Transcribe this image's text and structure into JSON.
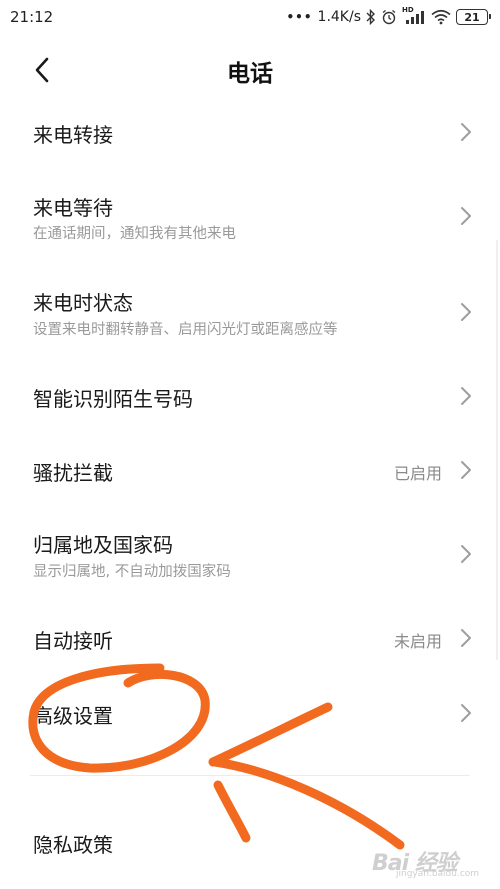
{
  "status_bar": {
    "time": "21:12",
    "net_speed": "1.4K/s",
    "hd_label": "HD",
    "battery_level": "21",
    "icons": [
      "dots-icon",
      "bluetooth-icon",
      "alarm-icon",
      "signal-icon",
      "wifi-icon",
      "battery-icon"
    ]
  },
  "header": {
    "title": "电话",
    "back_icon": "chevron-left-icon"
  },
  "items": [
    {
      "label": "来电转接"
    },
    {
      "label": "来电等待",
      "sub": "在通话期间，通知我有其他来电"
    },
    {
      "label": "来电时状态",
      "sub": "设置来电时翻转静音、启用闪光灯或距离感应等"
    },
    {
      "label": "智能识别陌生号码"
    },
    {
      "label": "骚扰拦截",
      "value": "已启用"
    },
    {
      "label": "归属地及国家码",
      "sub": "显示归属地, 不自动加拨国家码"
    },
    {
      "label": "自动接听",
      "value": "未启用"
    },
    {
      "label": "高级设置"
    },
    {
      "label": "隐私政策"
    }
  ],
  "watermark": {
    "main": "Bai 经验",
    "sub": "jingyan.baidu.com"
  },
  "colors": {
    "annotation": "#f26a1f",
    "chevron": "#9e9e9e",
    "subtext": "#9a9a9a"
  }
}
